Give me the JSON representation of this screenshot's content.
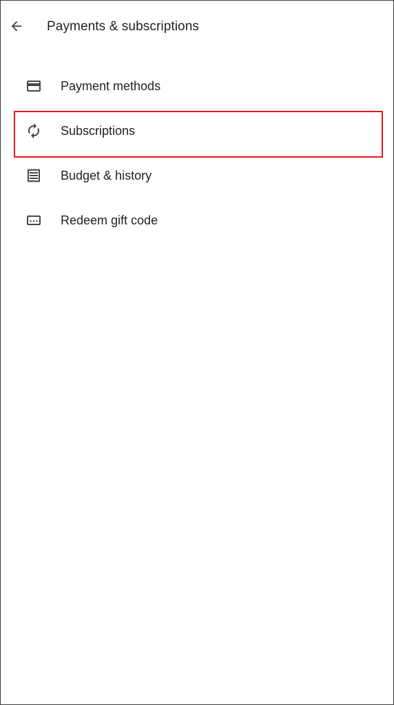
{
  "header": {
    "title": "Payments & subscriptions",
    "back_icon": "arrow-back-icon"
  },
  "menu": {
    "items": [
      {
        "label": "Payment methods",
        "icon": "credit-card-icon"
      },
      {
        "label": "Subscriptions",
        "icon": "refresh-cycle-icon"
      },
      {
        "label": "Budget & history",
        "icon": "receipt-icon"
      },
      {
        "label": "Redeem gift code",
        "icon": "gift-code-icon"
      }
    ]
  },
  "highlight": {
    "target": "Subscriptions",
    "color": "#e8141c"
  },
  "colors": {
    "text": "#202124",
    "icon": "#444746",
    "background": "#ffffff"
  }
}
